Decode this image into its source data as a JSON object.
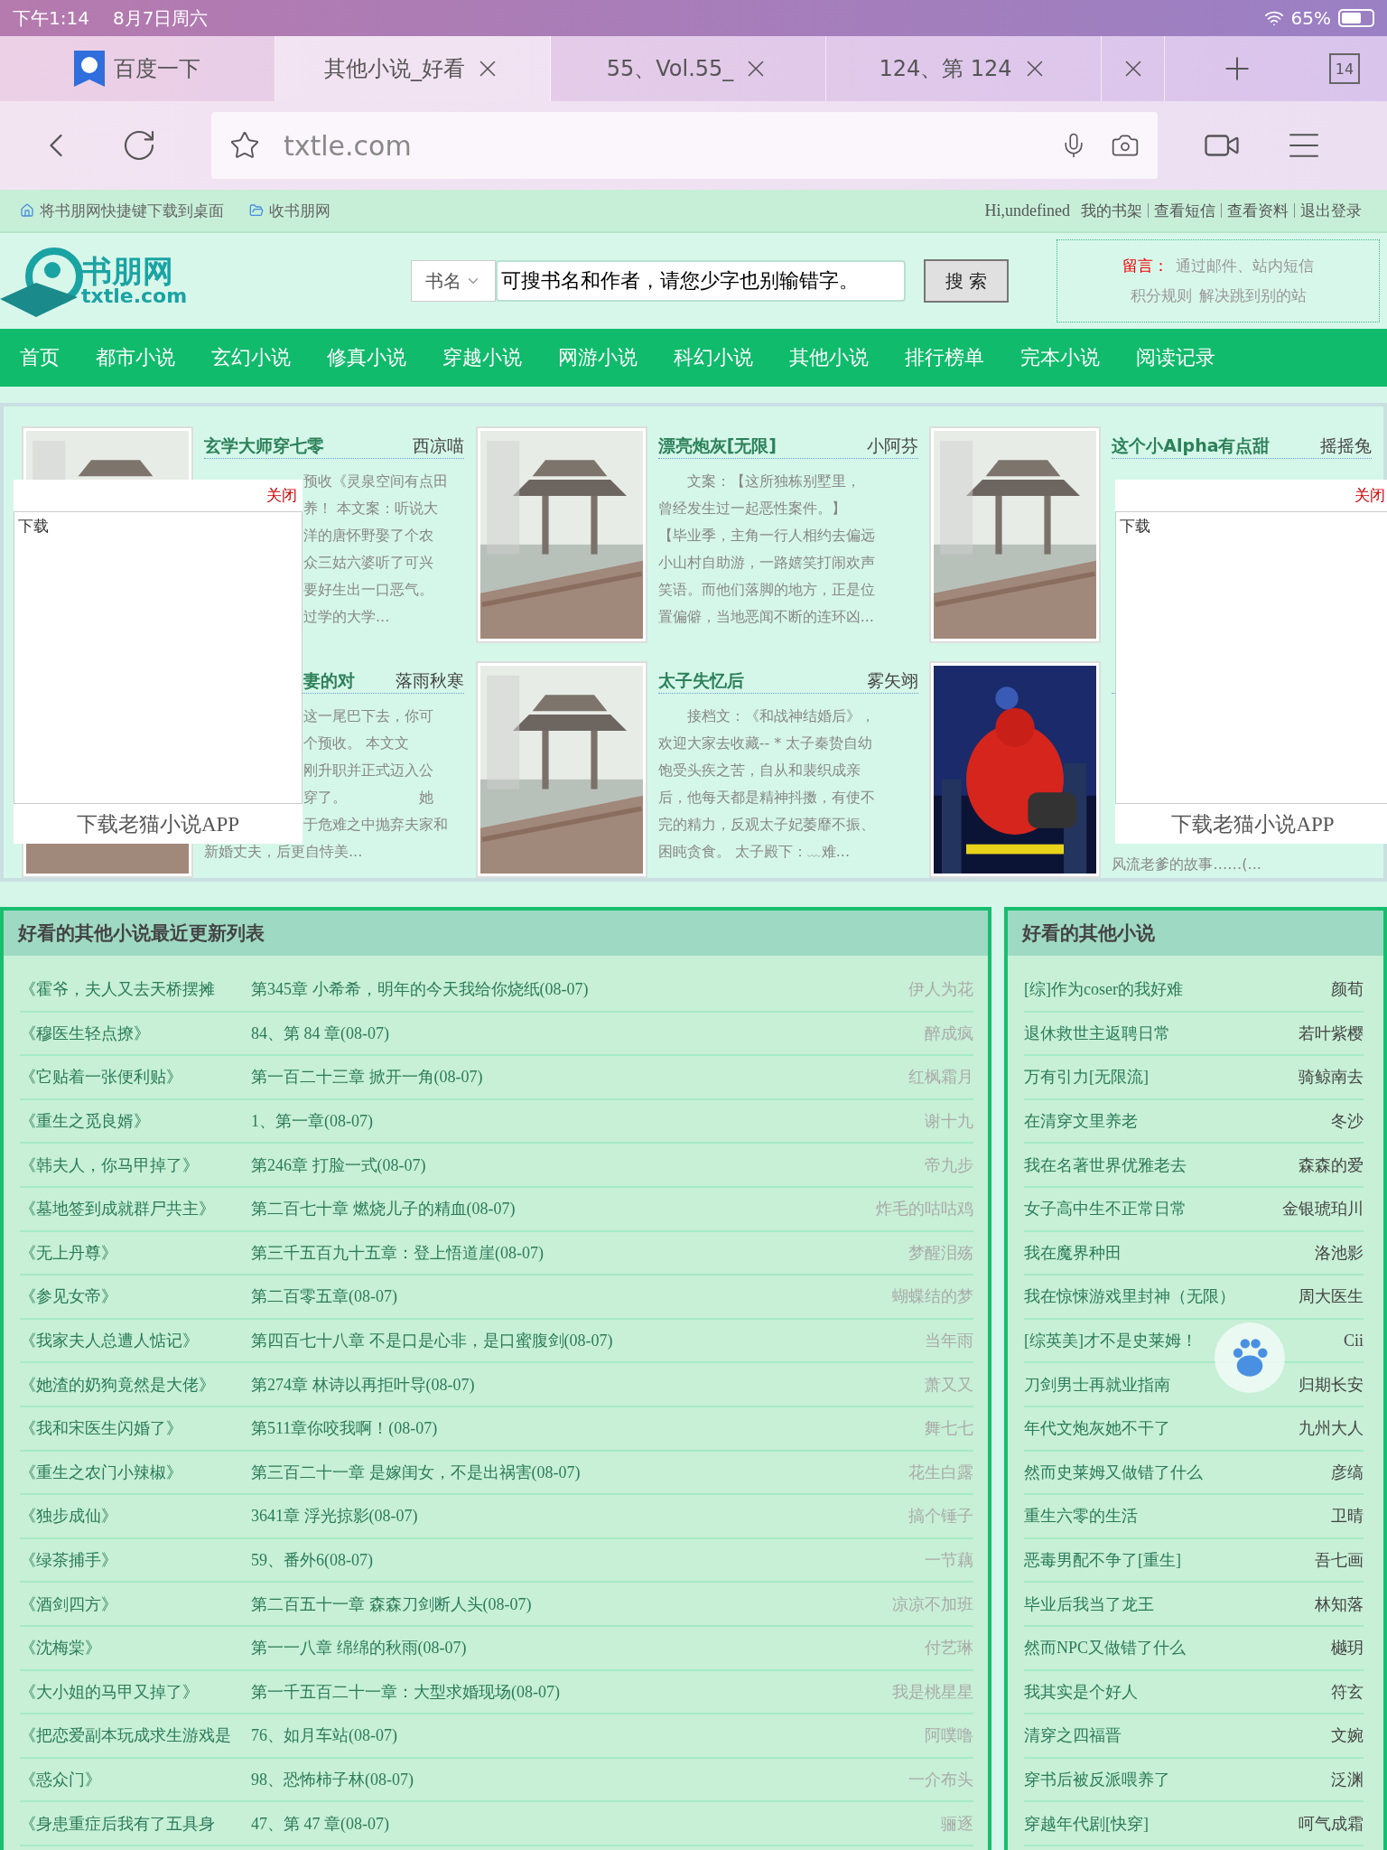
{
  "status_bar": {
    "time": "下午1:14",
    "date": "8月7日周六",
    "battery": "65%"
  },
  "tabs": [
    {
      "title": "百度一下",
      "favicon": true,
      "closable": false,
      "selected": false
    },
    {
      "title": "其他小说_好看",
      "favicon": false,
      "closable": true,
      "selected": true
    },
    {
      "title": "55、Vol.55_",
      "favicon": false,
      "closable": true,
      "selected": false
    },
    {
      "title": "124、第 124",
      "favicon": false,
      "closable": true,
      "selected": false
    },
    {
      "favicon": false,
      "closable": true,
      "selected": false
    }
  ],
  "tab_count": "14",
  "address_bar": {
    "url": "txtle.com"
  },
  "site_topbar": {
    "left": [
      "将书朋网快捷键下载到桌面",
      "收书朋网"
    ],
    "greeting": "Hi,undefined",
    "links": [
      "我的书架",
      "查看短信",
      "查看资料",
      "退出登录"
    ]
  },
  "logo": {
    "name": "书朋网",
    "domain": "txtle.com"
  },
  "search": {
    "scope": "书名",
    "value": "可搜书名和作者，请您少字也别输错字。",
    "button": "搜 索"
  },
  "notice": {
    "label": "留言：",
    "text": "通过邮件、站内短信",
    "links": [
      "积分规则",
      "解决跳到别的站"
    ]
  },
  "nav": [
    "首页",
    "都市小说",
    "玄幻小说",
    "修真小说",
    "穿越小说",
    "网游小说",
    "科幻小说",
    "其他小说",
    "排行榜单",
    "完本小说",
    "阅读记录"
  ],
  "featured": [
    {
      "kind": "picture",
      "title": "玄学大师穿七零",
      "author": "西凉喵",
      "lines": [
        {
          "text": "预收《灵泉空间有点田",
          "behind_popup": true
        },
        {
          "text": "养！ 本文案：听说大",
          "behind_popup": true
        },
        {
          "text": "洋的唐怀野娶了个农",
          "behind_popup": true
        },
        {
          "text": "众三姑六婆听了可兴",
          "behind_popup": true
        },
        {
          "text": "要好生出一口恶气。",
          "behind_popup": true
        },
        {
          "text": "过学的大学...",
          "behind_popup": true
        }
      ]
    },
    {
      "kind": "picture",
      "title": "漂亮炮灰[无限]",
      "author": "小阿芬",
      "lines": [
        {
          "text": "　　文案：【这所独栋别墅里，",
          "behind_popup": false
        },
        {
          "text": "曾经发生过一起恶性案件。】",
          "behind_popup": false
        },
        {
          "text": "【毕业季，主角一行人相约去偏远",
          "behind_popup": false
        },
        {
          "text": "小山村自助游，一路嬉笑打闹欢声",
          "behind_popup": false
        },
        {
          "text": "笑语。而他们落脚的地方，正是位",
          "behind_popup": false
        },
        {
          "text": "置偏僻，当地恶闻不断的连环凶...",
          "behind_popup": false
        }
      ]
    },
    {
      "kind": "picture",
      "title": "这个小Alpha有点甜",
      "author": "摇摇兔"
    },
    {
      "kind": "picture",
      "title": "妻的对",
      "author": "落雨秋寒",
      "title_behind_popup": true,
      "lines": [
        {
          "text": "这一尾巴下去，你可",
          "behind_popup": true
        },
        {
          "text": "个预收。 本文文",
          "behind_popup": true
        },
        {
          "text": "刚升职并正式迈入公",
          "behind_popup": true
        },
        {
          "text": "穿了。　　　　　她",
          "behind_popup": true
        },
        {
          "text": "于危难之中抛弃夫家和",
          "behind_popup": true
        },
        {
          "text": "新婚丈夫，后更自恃美...",
          "behind_popup": false
        }
      ]
    },
    {
      "kind": "picture",
      "title": "太子失忆后",
      "author": "雾矢翊",
      "lines": [
        {
          "text": "　　接档文：《和战神结婚后》，",
          "behind_popup": false
        },
        {
          "text": "欢迎大家去收藏-- * 太子秦贽自幼",
          "behind_popup": false
        },
        {
          "text": "饱受头疾之苦，自从和裴织成亲",
          "behind_popup": false
        },
        {
          "text": "后，他每天都是精神抖擞，有使不",
          "behind_popup": false
        },
        {
          "text": "完的精力，反观太子妃萎靡不振、",
          "behind_popup": false
        },
        {
          "text": "困盹贪食。 太子殿下：﹏难...",
          "behind_popup": false
        }
      ]
    },
    {
      "kind": "picture",
      "lines": [
        {
          "text": "风流老爹的故事……(...",
          "behind_popup": false
        }
      ]
    }
  ],
  "popups": [
    {
      "close": "关闭",
      "label": "下载",
      "footer": "下载老猫小说APP"
    },
    {
      "close": "关闭",
      "label": "下载",
      "footer": "下载老猫小说APP"
    }
  ],
  "updates": {
    "title": "好看的其他小说最近更新列表",
    "rows": [
      {
        "title": "《霍爷，夫人又去天桥摆摊",
        "chapter": "第345章 小希希，明年的今天我给你烧纸(08-07)",
        "author": "伊人为花"
      },
      {
        "title": "《穆医生轻点撩》",
        "chapter": "84、第 84 章(08-07)",
        "author": "醉成疯"
      },
      {
        "title": "《它贴着一张便利贴》",
        "chapter": "第一百二十三章 掀开一角(08-07)",
        "author": "红枫霜月"
      },
      {
        "title": "《重生之觅良婿》",
        "chapter": "1、第一章(08-07)",
        "author": "谢十九"
      },
      {
        "title": "《韩夫人，你马甲掉了》",
        "chapter": "第246章 打脸一式(08-07)",
        "author": "帝九步"
      },
      {
        "title": "《墓地签到成就群尸共主》",
        "chapter": "第二百七十章 燃烧儿子的精血(08-07)",
        "author": "炸毛的咕咕鸡"
      },
      {
        "title": "《无上丹尊》",
        "chapter": "第三千五百九十五章：登上悟道崖(08-07)",
        "author": "梦醒泪殇"
      },
      {
        "title": "《参见女帝》",
        "chapter": "第二百零五章(08-07)",
        "author": "蝴蝶结的梦"
      },
      {
        "title": "《我家夫人总遭人惦记》",
        "chapter": "第四百七十八章 不是口是心非，是口蜜腹剑(08-07)",
        "author": "当年雨"
      },
      {
        "title": "《她渣的奶狗竟然是大佬》",
        "chapter": "第274章 林诗以再拒叶导(08-07)",
        "author": "萧又又"
      },
      {
        "title": "《我和宋医生闪婚了》",
        "chapter": "第511章你咬我啊！(08-07)",
        "author": "舞七七"
      },
      {
        "title": "《重生之农门小辣椒》",
        "chapter": "第三百二十一章 是嫁闺女，不是出祸害(08-07)",
        "author": "花生白露"
      },
      {
        "title": "《独步成仙》",
        "chapter": "3641章 浮光掠影(08-07)",
        "author": "搞个锤子"
      },
      {
        "title": "《绿茶捕手》",
        "chapter": "59、番外6(08-07)",
        "author": "一节藕"
      },
      {
        "title": "《酒剑四方》",
        "chapter": "第二百五十一章  森森刀剑断人头(08-07)",
        "author": "凉凉不加班"
      },
      {
        "title": "《沈梅棠》",
        "chapter": "第一一八章 绵绵的秋雨(08-07)",
        "author": "付艺琳"
      },
      {
        "title": "《大小姐的马甲又掉了》",
        "chapter": "第一千五百二十一章：大型求婚现场(08-07)",
        "author": "我是桃星星"
      },
      {
        "title": "《把恋爱副本玩成求生游戏是",
        "chapter": "76、如月车站(08-07)",
        "author": "阿噗噜"
      },
      {
        "title": "《惑众门》",
        "chapter": "98、恐怖柿子林(08-07)",
        "author": "一介布头"
      },
      {
        "title": "《身患重症后我有了五具身",
        "chapter": "47、第 47 章(08-07)",
        "author": "骊逐"
      }
    ]
  },
  "popular": {
    "title": "好看的其他小说",
    "rows": [
      {
        "title": "[综]作为coser的我好难",
        "author": "颜荀"
      },
      {
        "title": "退休救世主返聘日常",
        "author": "若叶紫樱"
      },
      {
        "title": "万有引力[无限流]",
        "author": "骑鲸南去"
      },
      {
        "title": "在清穿文里养老",
        "author": "冬沙"
      },
      {
        "title": "我在名著世界优雅老去",
        "author": "森森的爱"
      },
      {
        "title": "女子高中生不正常日常",
        "author": "金银琥珀川"
      },
      {
        "title": "我在魔界种田",
        "author": "洛池影"
      },
      {
        "title": "我在惊悚游戏里封神（无限）",
        "author": "周大医生"
      },
      {
        "title": "[综英美]才不是史莱姆！",
        "author": "Cii"
      },
      {
        "title": "刀剑男士再就业指南",
        "author": "归期长安"
      },
      {
        "title": "年代文炮灰她不干了",
        "author": "九州大人"
      },
      {
        "title": "然而史莱姆又做错了什么",
        "author": "彦缟"
      },
      {
        "title": "重生六零的生活",
        "author": "卫晴"
      },
      {
        "title": "恶毒男配不争了[重生]",
        "author": "吾七画"
      },
      {
        "title": "毕业后我当了龙王",
        "author": "林知落"
      },
      {
        "title": "然而NPC又做错了什么",
        "author": "樾玥"
      },
      {
        "title": "我其实是个好人",
        "author": "符玄"
      },
      {
        "title": "清穿之四福晋",
        "author": "文婉"
      },
      {
        "title": "穿书后被反派喂养了",
        "author": "泛渊"
      },
      {
        "title": "穿越年代剧[快穿]",
        "author": "呵气成霜"
      }
    ]
  }
}
